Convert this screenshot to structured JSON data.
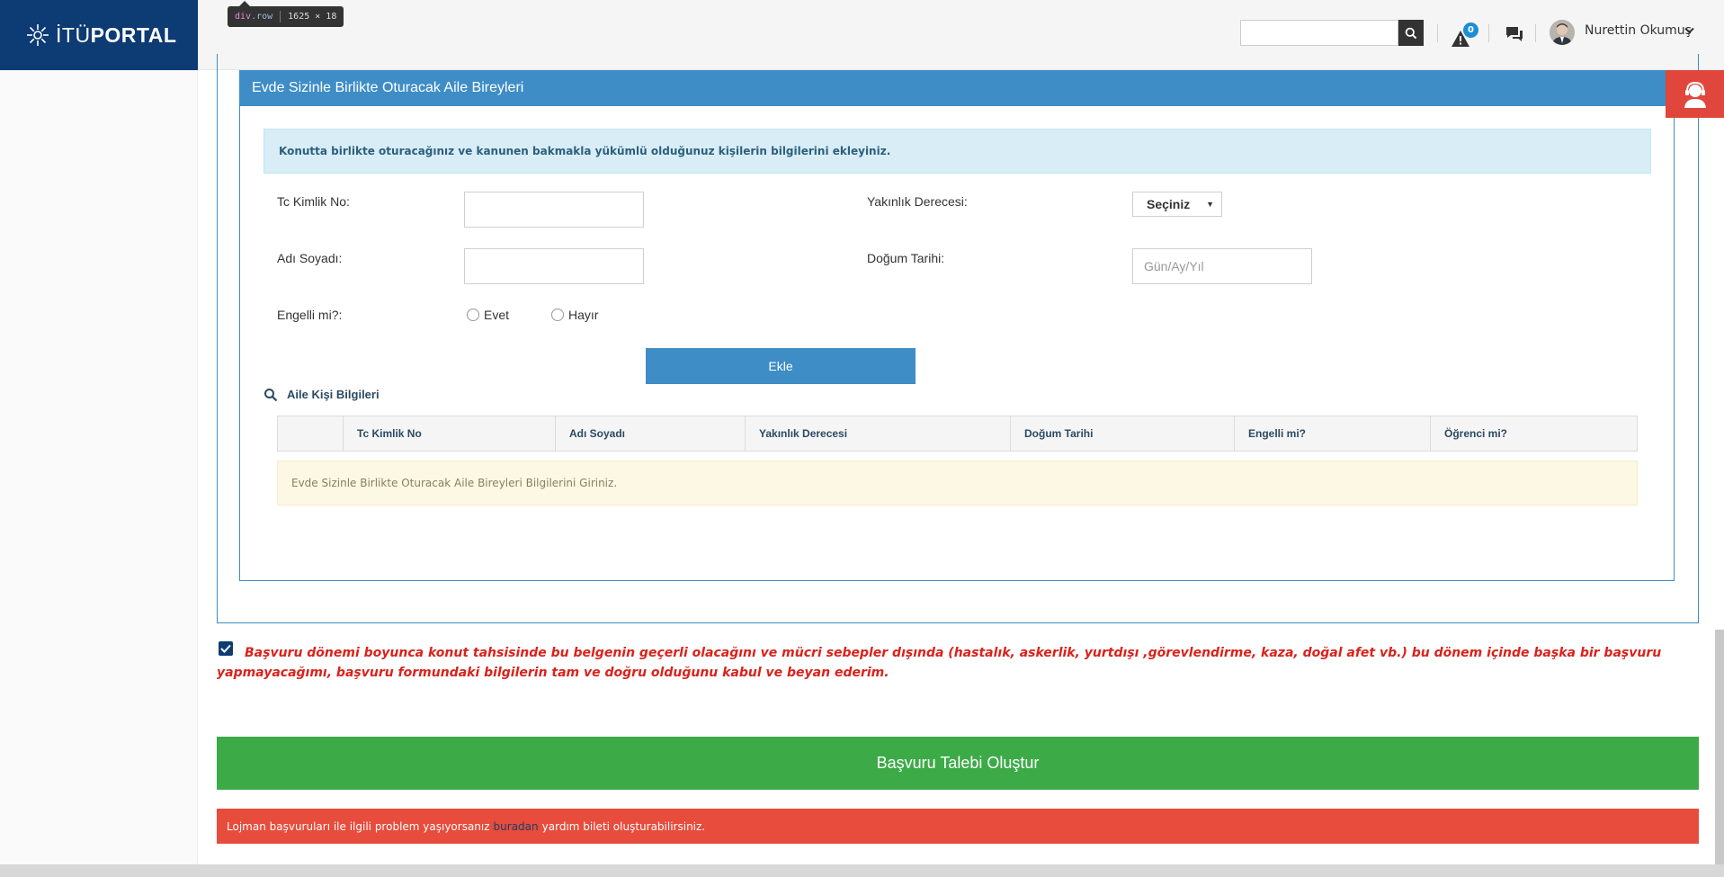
{
  "header": {
    "logo_text_thin": "İTÜ",
    "logo_text_bold": "PORTAL",
    "search_value": "",
    "notification_count": "0",
    "user_name": "Nurettin Okumuş"
  },
  "devtools_tooltip": {
    "tag": "div",
    "class_name": ".row",
    "size": "1625 × 18"
  },
  "panel": {
    "title": "Evde Sizinle Birlikte Oturacak Aile Bireyleri",
    "info": "Konutta birlikte oturacağınız ve kanunen bakmakla yükümlü olduğunuz kişilerin bilgilerini ekleyiniz."
  },
  "form": {
    "tc_label": "Tc Kimlik No:",
    "tc_value": "",
    "name_label": "Adı Soyadı:",
    "name_value": "",
    "relation_label": "Yakınlık Derecesi:",
    "relation_selected": "Seçiniz",
    "birth_label": "Doğum Tarihi:",
    "birth_placeholder": "Gün/Ay/Yıl",
    "disabled_label": "Engelli mi?:",
    "yes_label": "Evet",
    "no_label": "Hayır",
    "add_button": "Ekle"
  },
  "family_table": {
    "title": "Aile Kişi Bilgileri",
    "columns": [
      "",
      "Tc Kimlik No",
      "Adı Soyadı",
      "Yakınlık Derecesi",
      "Doğum Tarihi",
      "Engelli mi?",
      "Öğrenci mi?"
    ],
    "empty_message": "Evde Sizinle Birlikte Oturacak Aile Bireyleri Bilgilerini Giriniz."
  },
  "declaration": {
    "checked": true,
    "text": "Başvuru dönemi boyunca konut tahsisinde bu belgenin geçerli olacağını ve mücri sebepler dışında (hastalık, askerlik, yurtdışı ,görevlendirme, kaza, doğal afet vb.) bu dönem içinde başka bir başvuru yapmayacağımı, başvuru formundaki bilgilerin tam ve doğru olduğunu kabul ve beyan ederim."
  },
  "submit": {
    "label": "Başvuru Talebi Oluştur"
  },
  "alert": {
    "before": "Lojman başvuruları ile ilgili problem yaşıyorsanız",
    "link": "buradan",
    "after": "yardım bileti oluşturabilirsiniz."
  },
  "colors": {
    "brand": "#0d3b73",
    "panel_blue": "#3e8dc6",
    "success": "#3cab47",
    "danger": "#e74c3c"
  }
}
